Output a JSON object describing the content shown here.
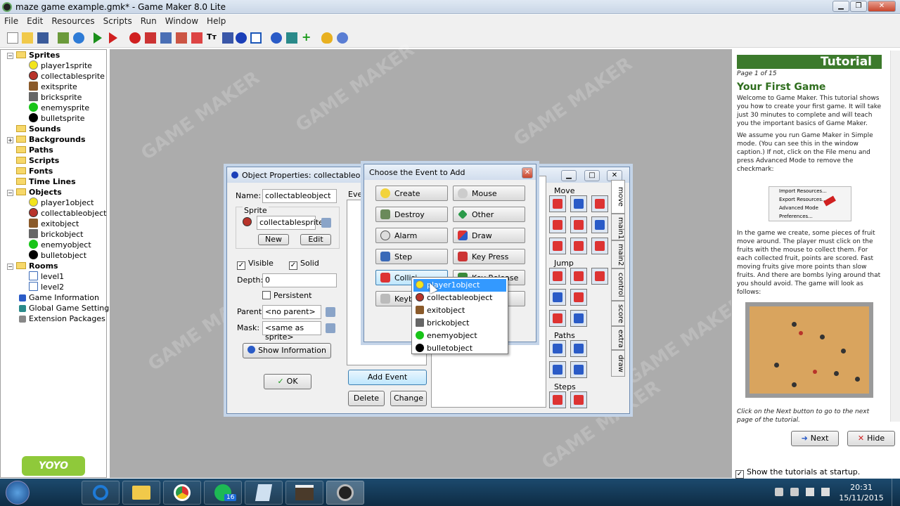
{
  "window": {
    "title": "maze game example.gmk* - Game Maker 8.0 Lite",
    "controls": [
      "minimize-icon",
      "restore-icon",
      "close-icon"
    ]
  },
  "menu": [
    "File",
    "Edit",
    "Resources",
    "Scripts",
    "Run",
    "Window",
    "Help"
  ],
  "toolbar_icons": [
    "new-icon",
    "open-icon",
    "save-icon",
    "publish-icon",
    "globe-icon",
    "run-icon",
    "debug-icon",
    "add-sprite-icon",
    "add-sound-icon",
    "add-background-icon",
    "add-path-icon",
    "add-script-icon",
    "add-font-icon",
    "add-timeline-icon",
    "add-object-icon",
    "add-room-icon",
    "game-info-icon",
    "global-settings-icon",
    "extensions-icon",
    "help-icon",
    "web-icon"
  ],
  "tree": {
    "sprites": "Sprites",
    "sprite_items": [
      "player1sprite",
      "collectablesprite",
      "exitsprite",
      "bricksprite",
      "enemysprite",
      "bulletsprite"
    ],
    "sounds": "Sounds",
    "backgrounds": "Backgrounds",
    "paths": "Paths",
    "scripts": "Scripts",
    "fonts": "Fonts",
    "timelines": "Time Lines",
    "objects": "Objects",
    "object_items": [
      "player1object",
      "collectableobject",
      "exitobject",
      "brickobject",
      "enemyobject",
      "bulletobject"
    ],
    "rooms": "Rooms",
    "room_items": [
      "level1",
      "level2"
    ],
    "game_info": "Game Information",
    "global_settings": "Global Game Settings",
    "extensions": "Extension Packages"
  },
  "logo": "YOYO GAMES",
  "watermark": "GAME MAKER",
  "object_props": {
    "title": "Object Properties: collectableobje",
    "name_label": "Name:",
    "name_value": "collectableobject",
    "sprite_group": "Sprite",
    "sprite_value": "collectablesprite",
    "new_button": "New",
    "edit_button": "Edit",
    "visible_label": "Visible",
    "solid_label": "Solid",
    "depth_label": "Depth:",
    "depth_value": "0",
    "persistent_label": "Persistent",
    "parent_label": "Parent:",
    "parent_value": "<no parent>",
    "mask_label": "Mask:",
    "mask_value": "<same as sprite>",
    "show_info_button": "Show Information",
    "ok_button": "OK",
    "events_label": "Even",
    "add_event_button": "Add Event",
    "delete_button": "Delete",
    "change_button": "Change",
    "move_label": "Move",
    "jump_label": "Jump",
    "paths_label": "Paths",
    "steps_label": "Steps",
    "tabs": [
      "move",
      "main1",
      "main2",
      "control",
      "score",
      "extra",
      "draw"
    ]
  },
  "choose_event": {
    "title": "Choose the Event to Add",
    "left": [
      "Create",
      "Destroy",
      "Alarm",
      "Step",
      "Collisi",
      "Keyb"
    ],
    "right": [
      "Mouse",
      "Other",
      "Draw",
      "Key Press",
      "Key Release",
      ""
    ]
  },
  "collision_menu": [
    "player1object",
    "collectableobject",
    "exitobject",
    "brickobject",
    "enemyobject",
    "bulletobject"
  ],
  "tutorial": {
    "header": "Tutorial",
    "page": "Page 1 of 15",
    "heading": "Your First Game",
    "p1": "Welcome to Game Maker. This tutorial shows you how to create your first game. It will take just 30 minutes to complete and will teach you the important basics of Game Maker.",
    "p2": "We assume you run Game Maker in Simple mode. (You can see this in the window caption.) If not, click on the File menu and press Advanced Mode to remove the checkmark:",
    "menu_items": [
      "Import Resources...",
      "Export Resources...",
      "Advanced Mode",
      "Preferences..."
    ],
    "p3": "In the game we create, some pieces of fruit move around. The player must click on the fruits with the mouse to collect them. For each collected fruit, points are scored. Fast moving fruits give more points than slow fruits. And there are bombs lying around that you should avoid. The game will look as follows:",
    "p4": "Click on the Next button to go to the next page of the tutorial.",
    "next_button": "Next",
    "hide_button": "Hide",
    "startup_label": "Show the tutorials at startup."
  },
  "taskbar": {
    "apps": [
      "start-icon",
      "ie-icon",
      "explorer-icon",
      "chrome-icon",
      "spotify-icon",
      "files-icon",
      "game-icon",
      "gamemaker-icon"
    ],
    "spotify_badge": "16",
    "time": "20:31",
    "date": "15/11/2015"
  },
  "colors": {
    "tutorial_header": "#3c7a2c",
    "tutorial_heading": "#2f6e1e",
    "workspace": "#acacac",
    "highlight": "#3399ff"
  }
}
